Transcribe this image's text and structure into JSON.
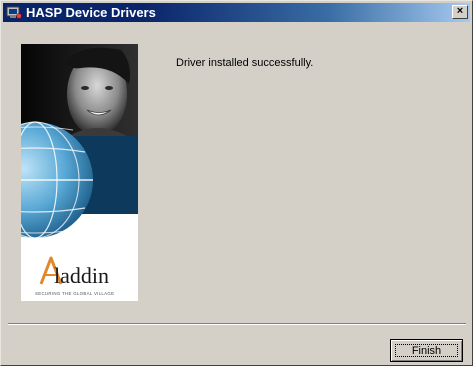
{
  "window": {
    "title": "HASP Device Drivers",
    "close_symbol": "×",
    "title_icon": "installer-icon"
  },
  "banner": {
    "logo_text": "Aladdin",
    "tagline": "SECURING THE GLOBAL VILLAGE",
    "colors": {
      "navy": "#0d3a5c",
      "globe": "#5aa9d6",
      "logo_orange": "#e0882a"
    }
  },
  "content": {
    "message": "Driver installed successfully."
  },
  "buttons": {
    "finish_label": "Finish"
  },
  "colors": {
    "titlebar_start": "#0a246a",
    "titlebar_end": "#a6caf0",
    "face": "#d4d0c8"
  }
}
